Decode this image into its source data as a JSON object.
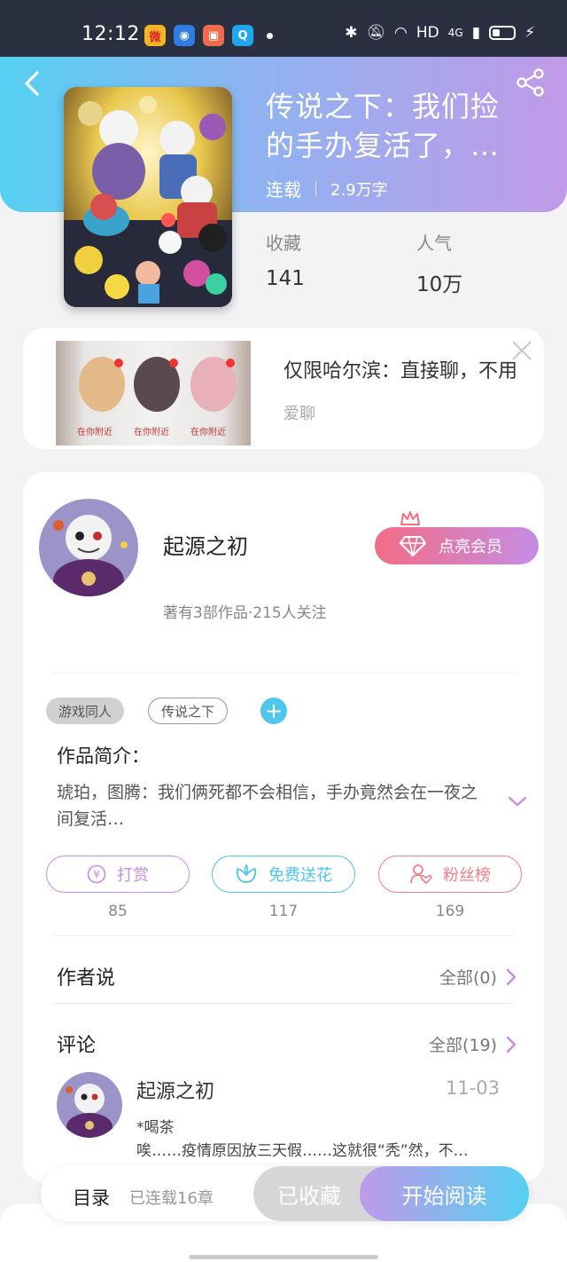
{
  "status_bar": {
    "time": "12:12",
    "network": "HD",
    "cell": "4G",
    "apps": [
      {
        "icon": "weibo-icon",
        "color": "#f5b326",
        "glyph": "微"
      },
      {
        "icon": "browser-icon",
        "color": "#2f7de0",
        "glyph": "◉"
      },
      {
        "icon": "game-icon",
        "color": "#f06b4d",
        "glyph": "▣"
      },
      {
        "icon": "qq-icon",
        "color": "#21a6f0",
        "glyph": "Q"
      }
    ]
  },
  "book": {
    "title": "传说之下：我们捡的手办复活了，…",
    "status": "连载",
    "word_count": "2.9万字",
    "favorites_label": "收藏",
    "favorites": "141",
    "popularity_label": "人气",
    "popularity": "10万"
  },
  "ad": {
    "title": "仅限哈尔滨：直接聊，不用",
    "source": "爱聊",
    "location_text": "在你附近"
  },
  "author": {
    "name": "起源之初",
    "stats": "著有3部作品·215人关注",
    "vip_label": "点亮会员"
  },
  "tags": [
    "游戏同人",
    "传说之下"
  ],
  "intro": {
    "heading": "作品简介：",
    "text": "琥珀，图腾：我们俩死都不会相信，手办竟然会在一夜之间复活…"
  },
  "actions": [
    {
      "label": "打赏",
      "count": "85",
      "color": "#c58de6"
    },
    {
      "label": "免费送花",
      "count": "117",
      "color": "#4fc6ea"
    },
    {
      "label": "粉丝榜",
      "count": "169",
      "color": "#f07f86"
    }
  ],
  "author_says": {
    "title": "作者说",
    "more": "全部(0)"
  },
  "comments": {
    "title": "评论",
    "more": "全部(19)",
    "items": [
      {
        "name": "起源之初",
        "date": "11-03",
        "line1": "*喝茶",
        "line2": "唉……疫情原因放三天假……这就很“秃”然，不…"
      }
    ]
  },
  "bottom": {
    "toc": "目录",
    "chapters": "已连载16章",
    "collected": "已收藏",
    "read": "开始阅读"
  },
  "colors": {
    "accent_purple": "#c58de6",
    "accent_cyan": "#4fc6ea",
    "accent_pink": "#f07f86"
  }
}
